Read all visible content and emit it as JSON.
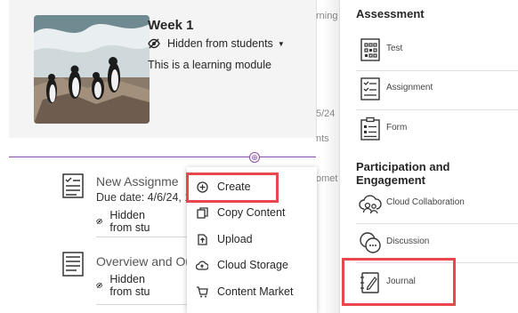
{
  "module": {
    "title": "Week 1",
    "visibility": "Hidden from students",
    "description": "This is a learning module"
  },
  "items": [
    {
      "title": "New Assignme",
      "due": "Due date: 4/6/24, 1",
      "visibility": "Hidden from stu"
    },
    {
      "title": "Overview and Ou",
      "visibility": "Hidden from stu"
    }
  ],
  "background_fragments": [
    "rning",
    "5/24",
    "nts",
    "omet"
  ],
  "menu": {
    "items": [
      {
        "label": "Create",
        "icon": "plus-circle-icon"
      },
      {
        "label": "Copy Content",
        "icon": "copy-icon"
      },
      {
        "label": "Upload",
        "icon": "upload-icon"
      },
      {
        "label": "Cloud Storage",
        "icon": "cloud-upload-icon"
      },
      {
        "label": "Content Market",
        "icon": "market-icon"
      }
    ]
  },
  "panel": {
    "assessment_title": "Assessment",
    "assessment_items": [
      {
        "label": "Test",
        "icon": "test-icon"
      },
      {
        "label": "Assignment",
        "icon": "assignment-icon"
      },
      {
        "label": "Form",
        "icon": "form-icon"
      }
    ],
    "participation_title": "Participation and Engagement",
    "participation_items": [
      {
        "label": "Cloud Collaboration",
        "icon": "cloud-collaboration-icon"
      },
      {
        "label": "Discussion",
        "icon": "discussion-icon"
      },
      {
        "label": "Journal",
        "icon": "journal-icon"
      }
    ]
  },
  "colors": {
    "highlight": "#e8474c",
    "insert_line": "#8a4ea6"
  }
}
